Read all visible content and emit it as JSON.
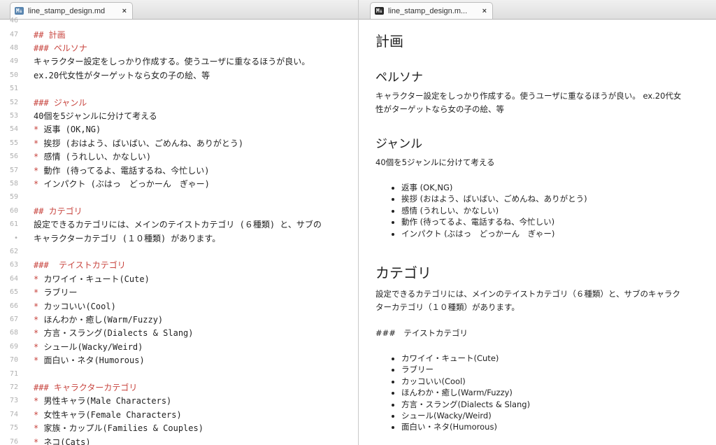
{
  "left_tab": {
    "icon": "M↓",
    "title": "line_stamp_design.md",
    "close": "×"
  },
  "right_tab": {
    "icon": "M↓",
    "title": "line_stamp_design.m...",
    "close": "×"
  },
  "editor": {
    "lines": [
      {
        "n": "46",
        "segments": []
      },
      {
        "n": "47",
        "segments": [
          {
            "t": "## 計画",
            "c": "t-heading"
          }
        ]
      },
      {
        "n": "48",
        "segments": [
          {
            "t": "### ペルソナ",
            "c": "t-heading"
          }
        ]
      },
      {
        "n": "49",
        "segments": [
          {
            "t": "キャラクター設定をしっかり作成する。使うユーザに重なるほうが良い。",
            "c": ""
          }
        ]
      },
      {
        "n": "50",
        "segments": [
          {
            "t": "ex.20代女性がターゲットなら女の子の絵、等",
            "c": ""
          }
        ]
      },
      {
        "n": "51",
        "segments": []
      },
      {
        "n": "52",
        "segments": [
          {
            "t": "### ジャンル",
            "c": "t-heading"
          }
        ]
      },
      {
        "n": "53",
        "segments": [
          {
            "t": "40個を5ジャンルに分けて考える",
            "c": ""
          }
        ]
      },
      {
        "n": "54",
        "segments": [
          {
            "t": "*",
            "c": "t-bullet"
          },
          {
            "t": " 返事 (OK,NG)",
            "c": ""
          }
        ]
      },
      {
        "n": "55",
        "segments": [
          {
            "t": "*",
            "c": "t-bullet"
          },
          {
            "t": " 挨拶 (おはよう、ばいばい、ごめんね、ありがとう)",
            "c": ""
          }
        ]
      },
      {
        "n": "56",
        "segments": [
          {
            "t": "*",
            "c": "t-bullet"
          },
          {
            "t": " 感情 (うれしい、かなしい)",
            "c": ""
          }
        ]
      },
      {
        "n": "57",
        "segments": [
          {
            "t": "*",
            "c": "t-bullet"
          },
          {
            "t": " 動作 (待ってるよ、電話するね、今忙しい)",
            "c": ""
          }
        ]
      },
      {
        "n": "58",
        "segments": [
          {
            "t": "*",
            "c": "t-bullet"
          },
          {
            "t": " インパクト (ぶはっ　どっかーん　ぎゃー)",
            "c": ""
          }
        ]
      },
      {
        "n": "59",
        "segments": []
      },
      {
        "n": "60",
        "segments": [
          {
            "t": "## カテゴリ",
            "c": "t-heading"
          }
        ]
      },
      {
        "n": "61",
        "segments": [
          {
            "t": "設定できるカテゴリには、メインのテイストカテゴリ (６種類) と、サブの",
            "c": ""
          }
        ]
      },
      {
        "n": "•",
        "segments": [
          {
            "t": "キャラクターカテゴリ (１０種類) があります。",
            "c": ""
          }
        ]
      },
      {
        "n": "62",
        "segments": []
      },
      {
        "n": "63",
        "segments": [
          {
            "t": "###  テイストカテゴリ",
            "c": "t-heading"
          }
        ]
      },
      {
        "n": "64",
        "segments": [
          {
            "t": "*",
            "c": "t-bullet"
          },
          {
            "t": " カワイイ・キュート(Cute)",
            "c": ""
          }
        ]
      },
      {
        "n": "65",
        "segments": [
          {
            "t": "*",
            "c": "t-bullet"
          },
          {
            "t": " ラブリー",
            "c": ""
          }
        ]
      },
      {
        "n": "66",
        "segments": [
          {
            "t": "*",
            "c": "t-bullet"
          },
          {
            "t": " カッコいい(Cool)",
            "c": ""
          }
        ]
      },
      {
        "n": "67",
        "segments": [
          {
            "t": "*",
            "c": "t-bullet"
          },
          {
            "t": " ほんわか・癒し(Warm/Fuzzy)",
            "c": ""
          }
        ]
      },
      {
        "n": "68",
        "segments": [
          {
            "t": "*",
            "c": "t-bullet"
          },
          {
            "t": " 方言・スラング(Dialects & Slang)",
            "c": ""
          }
        ]
      },
      {
        "n": "69",
        "segments": [
          {
            "t": "*",
            "c": "t-bullet"
          },
          {
            "t": " シュール(Wacky/Weird)",
            "c": ""
          }
        ]
      },
      {
        "n": "70",
        "segments": [
          {
            "t": "*",
            "c": "t-bullet"
          },
          {
            "t": " 面白い・ネタ(Humorous)",
            "c": ""
          }
        ]
      },
      {
        "n": "71",
        "segments": []
      },
      {
        "n": "72",
        "segments": [
          {
            "t": "### キャラクターカテゴリ",
            "c": "t-heading"
          }
        ]
      },
      {
        "n": "73",
        "segments": [
          {
            "t": "*",
            "c": "t-bullet"
          },
          {
            "t": " 男性キャラ(Male Characters)",
            "c": ""
          }
        ]
      },
      {
        "n": "74",
        "segments": [
          {
            "t": "*",
            "c": "t-bullet"
          },
          {
            "t": " 女性キャラ(Female Characters)",
            "c": ""
          }
        ]
      },
      {
        "n": "75",
        "segments": [
          {
            "t": "*",
            "c": "t-bullet"
          },
          {
            "t": " 家族・カップル(Families & Couples)",
            "c": ""
          }
        ]
      },
      {
        "n": "76",
        "segments": [
          {
            "t": "*",
            "c": "t-bullet"
          },
          {
            "t": " ネコ(Cats)",
            "c": ""
          }
        ]
      }
    ]
  },
  "preview": {
    "h_plan": "計画",
    "h_persona": "ペルソナ",
    "persona_text_1": "キャラクター設定をしっかり作成する。使うユーザに重なるほうが良い。 ex.20代女",
    "persona_text_2": "性がターゲットなら女の子の絵、等",
    "h_genre": "ジャンル",
    "genre_text": "40個を5ジャンルに分けて考える",
    "genre_items": [
      "返事 (OK,NG)",
      "挨拶 (おはよう、ばいばい、ごめんね、ありがとう)",
      "感情 (うれしい、かなしい)",
      "動作 (待ってるよ、電話するね、今忙しい)",
      "インパクト (ぶはっ　どっかーん　ぎゃー)"
    ],
    "h_category": "カテゴリ",
    "category_text_1": "設定できるカテゴリには、メインのテイストカテゴリ（６種類）と、サブのキャラク",
    "category_text_2": "ターカテゴリ（１０種類）があります。",
    "taste_raw": "###　テイストカテゴリ",
    "taste_items": [
      "カワイイ・キュート(Cute)",
      "ラブリー",
      "カッコいい(Cool)",
      "ほんわか・癒し(Warm/Fuzzy)",
      "方言・スラング(Dialects & Slang)",
      "シュール(Wacky/Weird)",
      "面白い・ネタ(Humorous)"
    ]
  }
}
